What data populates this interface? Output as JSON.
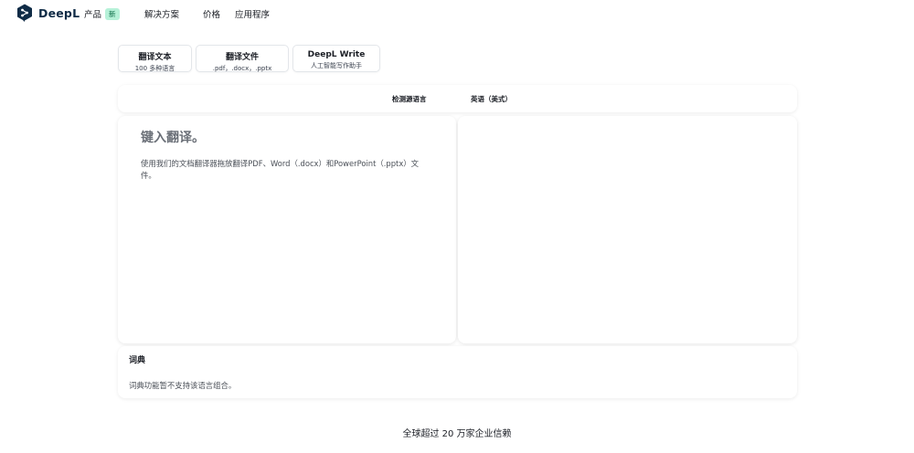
{
  "brand": {
    "name": "DeepL",
    "color": "#0f2b46"
  },
  "nav": {
    "products": "产品",
    "products_badge": "新",
    "solutions": "解决方案",
    "pricing": "价格",
    "apps": "应用程序"
  },
  "modes": [
    {
      "title": "翻译文本",
      "subtitle": "100 多种语言"
    },
    {
      "title": "翻译文件",
      "subtitle": ".pdf，.docx，.pptx"
    },
    {
      "title": "DeepL Write",
      "subtitle": "人工智能写作助手"
    }
  ],
  "language_bar": {
    "source": "检测源语言",
    "target": "英语（美式）"
  },
  "source_panel": {
    "placeholder": "键入翻译。",
    "hint": "使用我们的文档翻译器拖放翻译PDF、Word（.docx）和PowerPoint（.pptx）文件。"
  },
  "dictionary": {
    "title": "词典",
    "note": "词典功能暂不支持该语言组合。"
  },
  "footer": {
    "trust_text": "全球超过 20 万家企业信赖"
  },
  "icons": {
    "logo": "deepl-logo-icon"
  }
}
